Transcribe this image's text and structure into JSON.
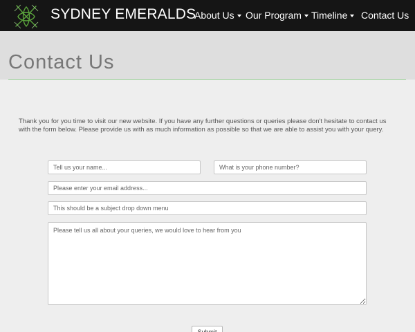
{
  "header": {
    "brand": "SYDNEY EMERALDS",
    "nav": [
      {
        "label": "About Us",
        "dropdown": true
      },
      {
        "label": "Our Program",
        "dropdown": true
      },
      {
        "label": "Timeline",
        "dropdown": true
      },
      {
        "label": "Contact Us",
        "dropdown": false
      }
    ]
  },
  "page": {
    "title": "Contact Us",
    "intro": "Thank you for you time to visit our new website. If you have any further questions or queries please don't hesitate to contact us with the form below. Please provide us with as much information as possible so that we are able to assist you with your query."
  },
  "form": {
    "name_placeholder": "Tell us your name...",
    "phone_placeholder": "What is your phone number?",
    "email_placeholder": "Please enter your email address...",
    "subject_placeholder": "This should be a subject drop down menu",
    "message_placeholder": "Please tell us all about your queries, we would love to hear from you",
    "submit_label": "Submit"
  },
  "colors": {
    "navbar": "#151515",
    "title_band": "#dedede",
    "accent_rule": "#8ec98a",
    "page_bg": "#eeeeee",
    "logo_green": "#5aa33c"
  }
}
